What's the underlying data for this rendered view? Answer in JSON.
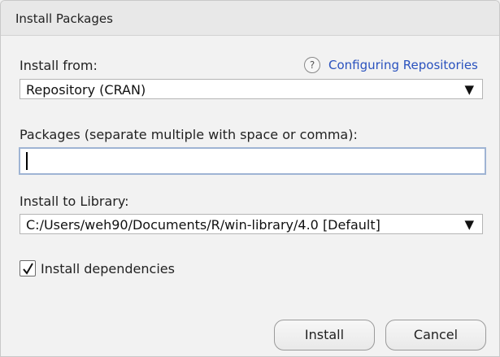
{
  "window": {
    "title": "Install Packages"
  },
  "install_from": {
    "label": "Install from:",
    "help_icon_glyph": "?",
    "help_link": "Configuring Repositories",
    "selected": "Repository (CRAN)"
  },
  "packages": {
    "label": "Packages (separate multiple with space or comma):",
    "value": "",
    "placeholder": ""
  },
  "library": {
    "label": "Install to Library:",
    "selected": "C:/Users/weh90/Documents/R/win-library/4.0 [Default]"
  },
  "dependencies": {
    "label": "Install dependencies",
    "checked": true
  },
  "buttons": {
    "install": "Install",
    "cancel": "Cancel"
  },
  "icons": {
    "help": "question-circle-icon",
    "dropdown": "triangle-down-icon",
    "check": "checkmark-icon"
  },
  "colors": {
    "link": "#2a52be",
    "focus_border": "#9fb4d4"
  }
}
